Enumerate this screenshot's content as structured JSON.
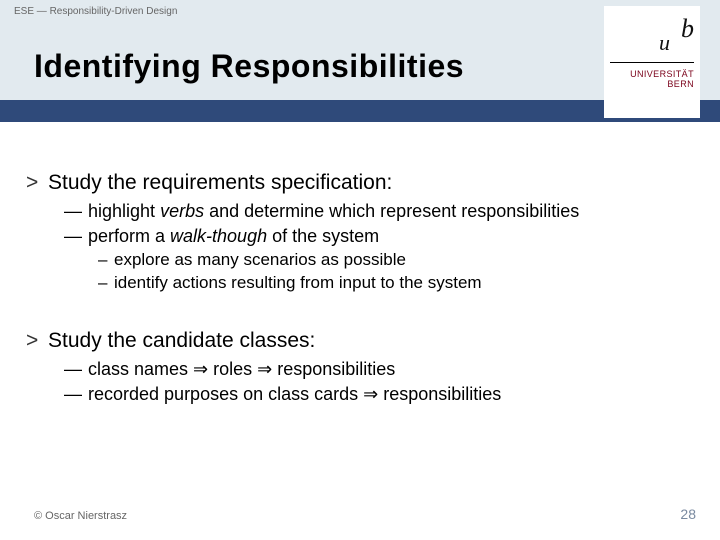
{
  "header": {
    "breadcrumb": "ESE — Responsibility-Driven Design",
    "title": "Identifying Responsibilities"
  },
  "logo": {
    "u": "u",
    "b": "b",
    "line1": "UNIVERSITÄT",
    "line2": "BERN",
    "stub1": "b",
    "stub2": "b"
  },
  "body": {
    "s1": {
      "mk": ">",
      "text": "Study the requirements specification:",
      "b1": {
        "mk": "—",
        "pre": "highlight ",
        "em": "verbs",
        "post": " and determine which represent responsibilities"
      },
      "b2": {
        "mk": "—",
        "pre": "perform a ",
        "em": "walk-though",
        "post": " of the system",
        "c1": {
          "mk": "–",
          "text": "explore as many scenarios as possible"
        },
        "c2": {
          "mk": "–",
          "text": "identify actions resulting from input to the system"
        }
      }
    },
    "s2": {
      "mk": ">",
      "text": "Study the candidate classes:",
      "b1": {
        "mk": "—",
        "text": "class names ⇒ roles ⇒ responsibilities"
      },
      "b2": {
        "mk": "—",
        "text": "recorded purposes on class cards ⇒ responsibilities"
      }
    }
  },
  "footer": {
    "copyright": "© Oscar Nierstrasz",
    "page": "28"
  }
}
